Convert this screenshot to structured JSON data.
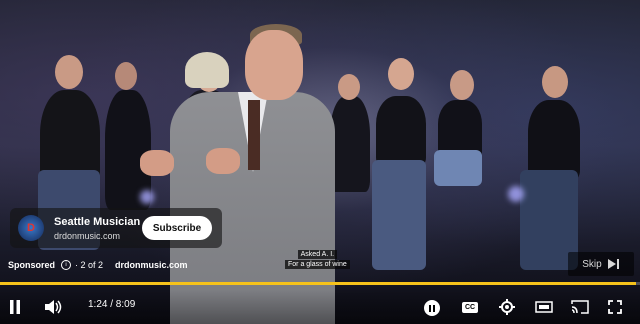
{
  "ad": {
    "title": "Seattle Musician",
    "url": "drdonmusic.com",
    "avatar_text": "D",
    "subscribe_label": "Subscribe",
    "sponsored_label": "Sponsored",
    "position_label": "· 2 of 2",
    "link_text": "drdonmusic.com"
  },
  "captions": [
    "Asked A. I.",
    "For a glass of wine"
  ],
  "skip": {
    "label": "Skip",
    "icon": "skip-next-icon"
  },
  "progress": {
    "fraction": 0.994,
    "color": "#f6c21b"
  },
  "controls": {
    "time_display": "1:24 / 8:09",
    "icons": [
      "pause-icon",
      "volume-icon",
      "miniplayer-pause-icon",
      "captions-icon",
      "settings-icon",
      "theater-icon",
      "cast-icon",
      "fullscreen-icon"
    ],
    "cc_label": "CC"
  }
}
